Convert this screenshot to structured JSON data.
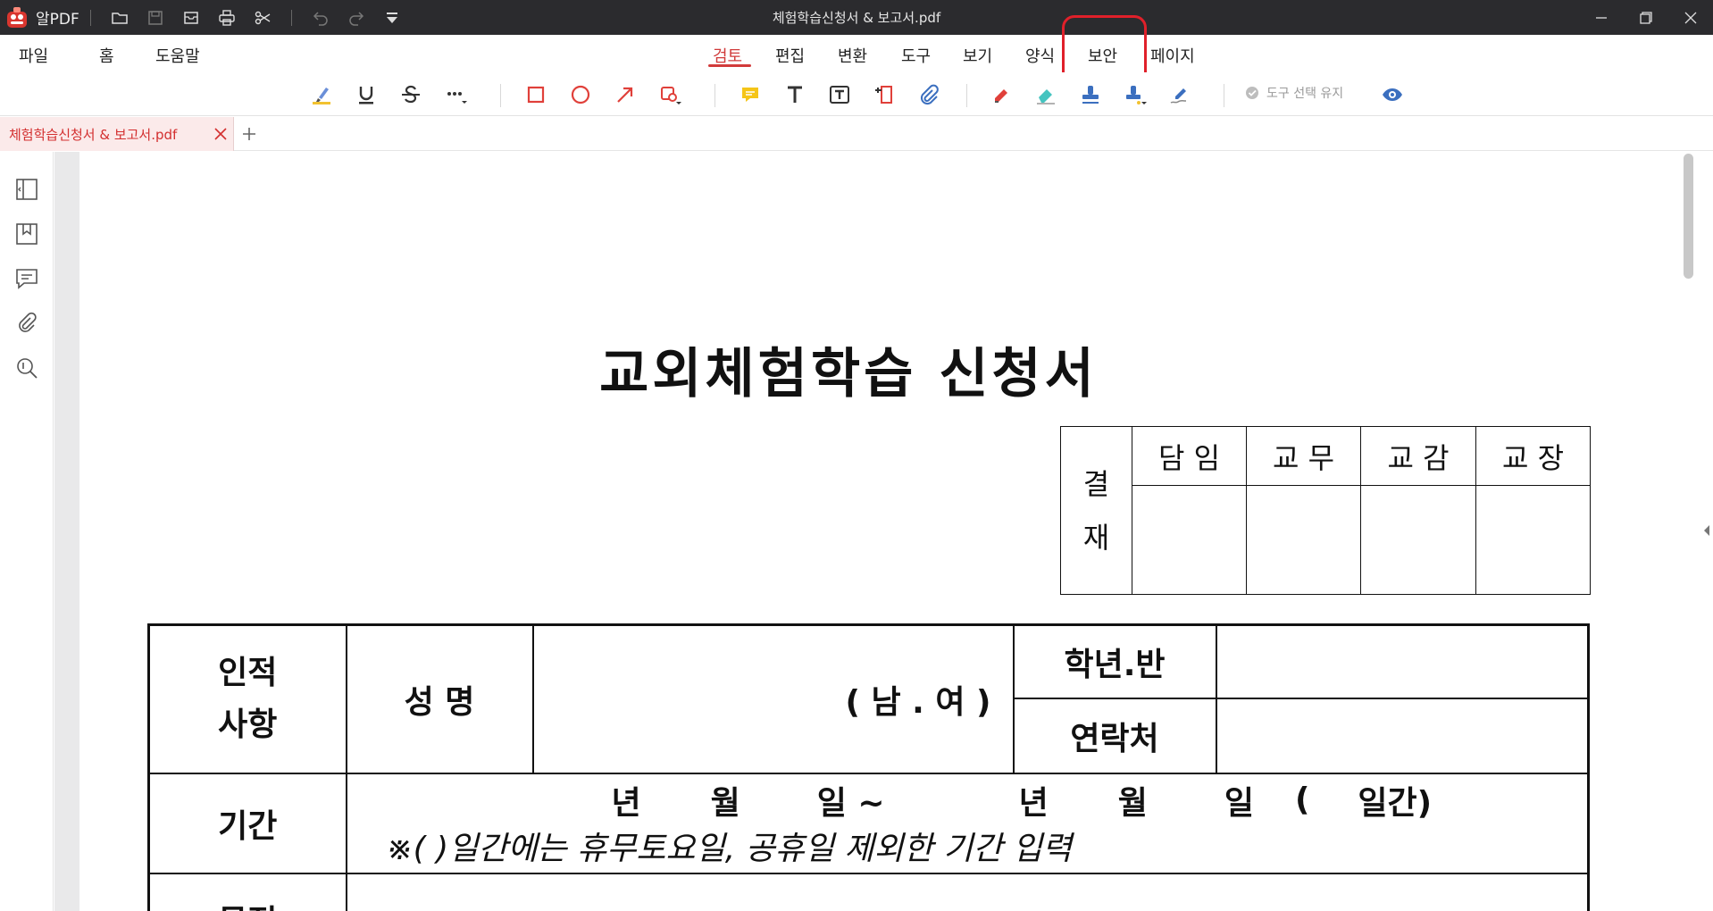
{
  "titlebar": {
    "app_name": "알PDF",
    "window_title": "체험학습신청서 & 보고서.pdf",
    "quick_icons": [
      "open-folder-icon",
      "save-icon",
      "mail-icon",
      "print-icon",
      "scissors-icon",
      "undo-icon",
      "redo-icon",
      "customize-icon"
    ]
  },
  "menu": {
    "items": [
      "파일",
      "홈",
      "도움말"
    ],
    "tabs": [
      "검토",
      "편집",
      "변환",
      "도구",
      "보기",
      "양식",
      "보안",
      "페이지"
    ],
    "active_tab": "검토",
    "highlighted_tab": "보안"
  },
  "toolbar": {
    "keep_tool_label": "도구 선택 유지"
  },
  "doc_tab": {
    "label": "체험학습신청서 & 보고서.pdf"
  },
  "colors": {
    "accent": "#d23b3b",
    "titlebar_bg": "#2b2b2e",
    "highlight": "#e0202a"
  },
  "document": {
    "title": "교외체험학습 신청서",
    "approval": {
      "side": "결\n재",
      "side_top": "결",
      "side_bottom": "재",
      "cols": [
        "담 임",
        "교 무",
        "교 감",
        "교 장"
      ]
    },
    "table": {
      "personal_info": "인적",
      "personal_info2": "사항",
      "name_label": "성   명",
      "gender": "( 남 . 여 )",
      "grade_class": "학년.반",
      "contact": "연락처",
      "period_label": "기간",
      "period_parts": [
        "년",
        "월",
        "일 ~",
        "년",
        "월",
        "일",
        "(",
        "일간)"
      ],
      "period_note": "※(        )일간에는 휴무토요일, 공휴일 제외한 기간 입력",
      "purpose_label": "목적"
    }
  }
}
